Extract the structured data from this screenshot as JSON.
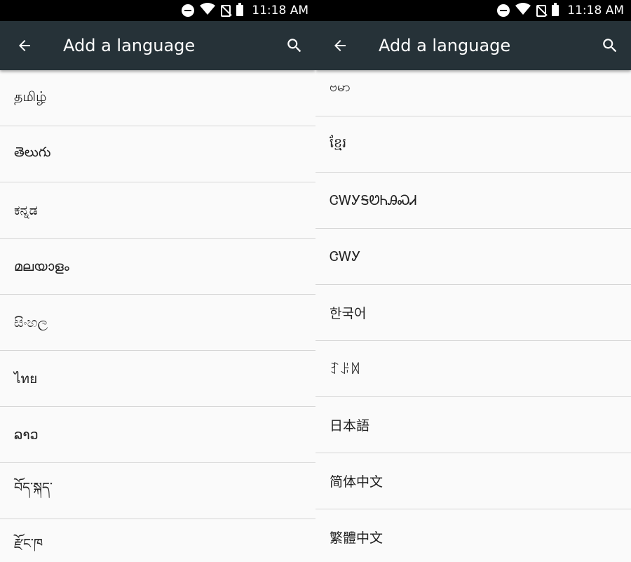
{
  "status_bar": {
    "time": "11:18 AM"
  },
  "app_bar": {
    "title": "Add a language"
  },
  "left_list": [
    "தமிழ்",
    "తెలుగు",
    "ಕನ್ನಡ",
    "മലയാളം",
    "සිංහල",
    "ไทย",
    "ລາວ",
    "བོད་སྐད་",
    "རྫོང་ཁ"
  ],
  "right_list": [
    "ဗမာ",
    "ខ្មែរ",
    "ᏣᎳᎩᎦᏬᏂᎯᏍᏗ",
    "ᏣᎳᎩ",
    "한국어",
    "ꆈꌠꉙ",
    "日本語",
    "简体中文",
    "繁體中文"
  ],
  "colors": {
    "app_bar": "#263238",
    "status_bar": "#000000",
    "background": "#fafafa",
    "divider": "#d6d6d6"
  }
}
